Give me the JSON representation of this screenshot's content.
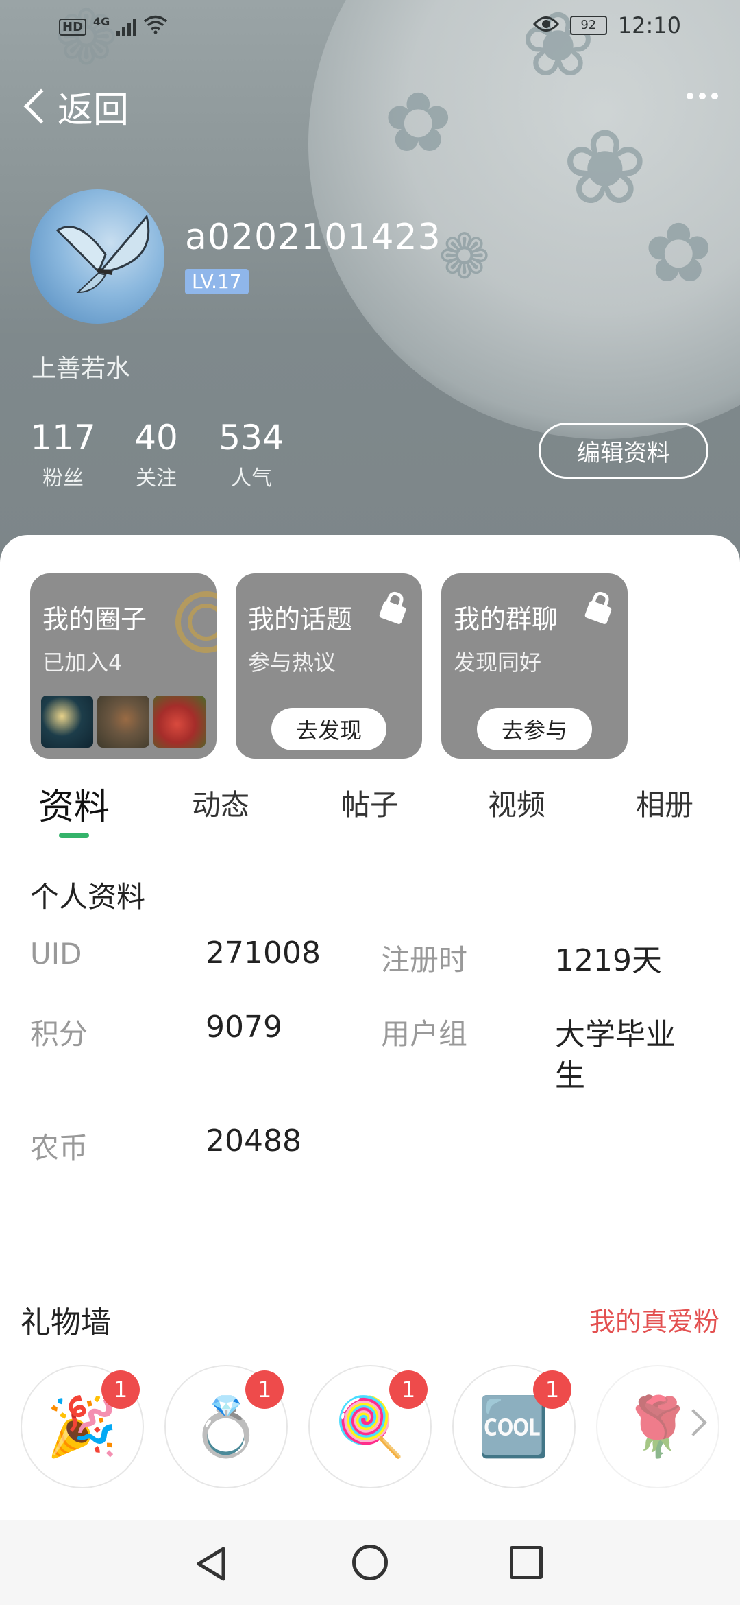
{
  "status_bar": {
    "hd": "HD",
    "network": "4G",
    "battery": "92",
    "time": "12:10"
  },
  "nav": {
    "back_label": "返回"
  },
  "profile": {
    "username": "a0202101423",
    "level": "LV.17",
    "signature": "上善若水",
    "stats": [
      {
        "num": "117",
        "label": "粉丝"
      },
      {
        "num": "40",
        "label": "关注"
      },
      {
        "num": "534",
        "label": "人气"
      }
    ],
    "edit_button": "编辑资料"
  },
  "cards": [
    {
      "title": "我的圈子",
      "subtitle": "已加入4"
    },
    {
      "title": "我的话题",
      "subtitle": "参与热议",
      "button": "去发现"
    },
    {
      "title": "我的群聊",
      "subtitle": "发现同好",
      "button": "去参与"
    }
  ],
  "tabs": [
    "资料",
    "动态",
    "帖子",
    "视频",
    "相册"
  ],
  "info": {
    "section_title": "个人资料",
    "rows": [
      {
        "k1": "UID",
        "v1": "271008",
        "k2": "注册时",
        "v2": "1219天"
      },
      {
        "k1": "积分",
        "v1": "9079",
        "k2": "用户组",
        "v2a": "大学毕业",
        "v2b": "生"
      },
      {
        "k1": "农币",
        "v1": "20488"
      }
    ]
  },
  "gifts": {
    "title": "礼物墙",
    "link": "我的真爱粉",
    "items": [
      {
        "icon": "party-popper-icon",
        "glyph": "🎉",
        "count": "1"
      },
      {
        "icon": "ring-icon",
        "glyph": "💍",
        "count": "1"
      },
      {
        "icon": "lollipop-icon",
        "glyph": "🍭",
        "count": "1"
      },
      {
        "icon": "cool-sticker-icon",
        "glyph": "🆒",
        "count": "1"
      },
      {
        "icon": "rose-icon",
        "glyph": "🌹"
      }
    ]
  },
  "colors": {
    "accent_green": "#34b36a",
    "gift_link_red": "#e35050",
    "badge_red": "#ee4b4b",
    "level_blue": "#8fb6ea"
  }
}
